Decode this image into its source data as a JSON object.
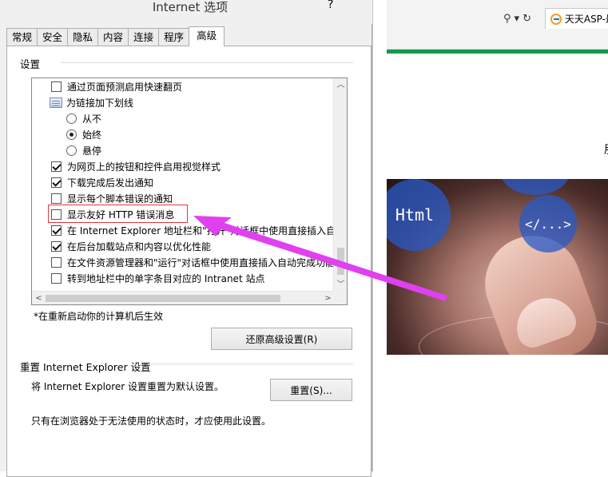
{
  "dialog": {
    "title": "Internet 选项",
    "help": "?",
    "tabs": [
      "常规",
      "安全",
      "隐私",
      "内容",
      "连接",
      "程序",
      "高级"
    ],
    "active_tab": "高级",
    "settings_label": "设置",
    "items": [
      {
        "type": "checkbox",
        "label": "通过页面预测启用快速翻页",
        "checked": false
      },
      {
        "type": "group",
        "label": "为链接加下划线"
      },
      {
        "type": "radio",
        "label": "从不",
        "checked": false
      },
      {
        "type": "radio",
        "label": "始终",
        "checked": true
      },
      {
        "type": "radio",
        "label": "悬停",
        "checked": false
      },
      {
        "type": "checkbox",
        "label": "为网页上的按钮和控件启用视觉样式",
        "checked": true
      },
      {
        "type": "checkbox",
        "label": "下载完成后发出通知",
        "checked": true
      },
      {
        "type": "checkbox",
        "label": "显示每个脚本错误的通知",
        "checked": false
      },
      {
        "type": "checkbox",
        "label": "显示友好 HTTP 错误消息",
        "checked": false
      },
      {
        "type": "checkbox",
        "label": "在 Internet Explorer 地址栏和\"打开\"对话框中使用直接插入自",
        "checked": true
      },
      {
        "type": "checkbox",
        "label": "在后台加载站点和内容以优化性能",
        "checked": true
      },
      {
        "type": "checkbox",
        "label": "在文件资源管理器和\"运行\"对话框中使用直接插入自动完成功能",
        "checked": false
      },
      {
        "type": "checkbox",
        "label": "转到地址栏中的单字条目对应的 Intranet 站点",
        "checked": false
      }
    ],
    "restart_note": "*在重新启动你的计算机后生效",
    "restore_button": "还原高级设置(R)",
    "reset_group_label": "重置 Internet Explorer 设置",
    "reset_description": "将 Internet Explorer 设置重置为默认设置。",
    "reset_button": "重置(S)...",
    "reset_note": "只有在浏览器处于无法使用的状态时，才应使用此设置。"
  },
  "browser": {
    "tab_title": "天天ASP-最专",
    "side_glyph": "朋",
    "hero_labels": [
      "Html",
      "</...>",
      "[…]"
    ],
    "accent_color": "#119a4d"
  },
  "annotation": {
    "color": "#e0373d",
    "arrow_color": "#e040f0"
  }
}
